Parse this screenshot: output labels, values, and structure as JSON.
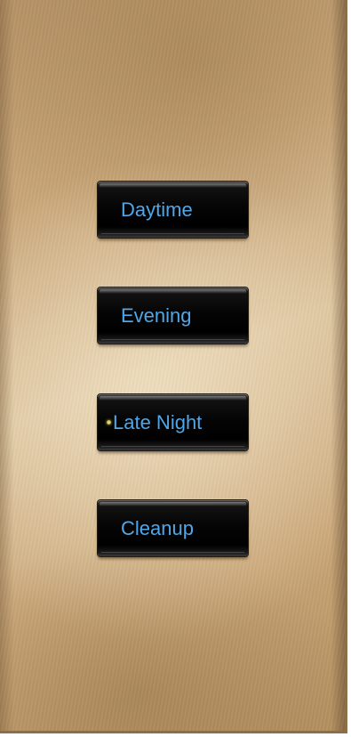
{
  "keypad": {
    "buttons": [
      {
        "id": "daytime",
        "label": "Daytime",
        "active": false
      },
      {
        "id": "evening",
        "label": "Evening",
        "active": false
      },
      {
        "id": "late-night",
        "label": "Late Night",
        "active": true
      },
      {
        "id": "cleanup",
        "label": "Cleanup",
        "active": false
      }
    ]
  },
  "colors": {
    "plate": "#c9a678",
    "button_face": "#000000",
    "label_text": "#4fa6e8",
    "led_active": "#e0d66a"
  }
}
